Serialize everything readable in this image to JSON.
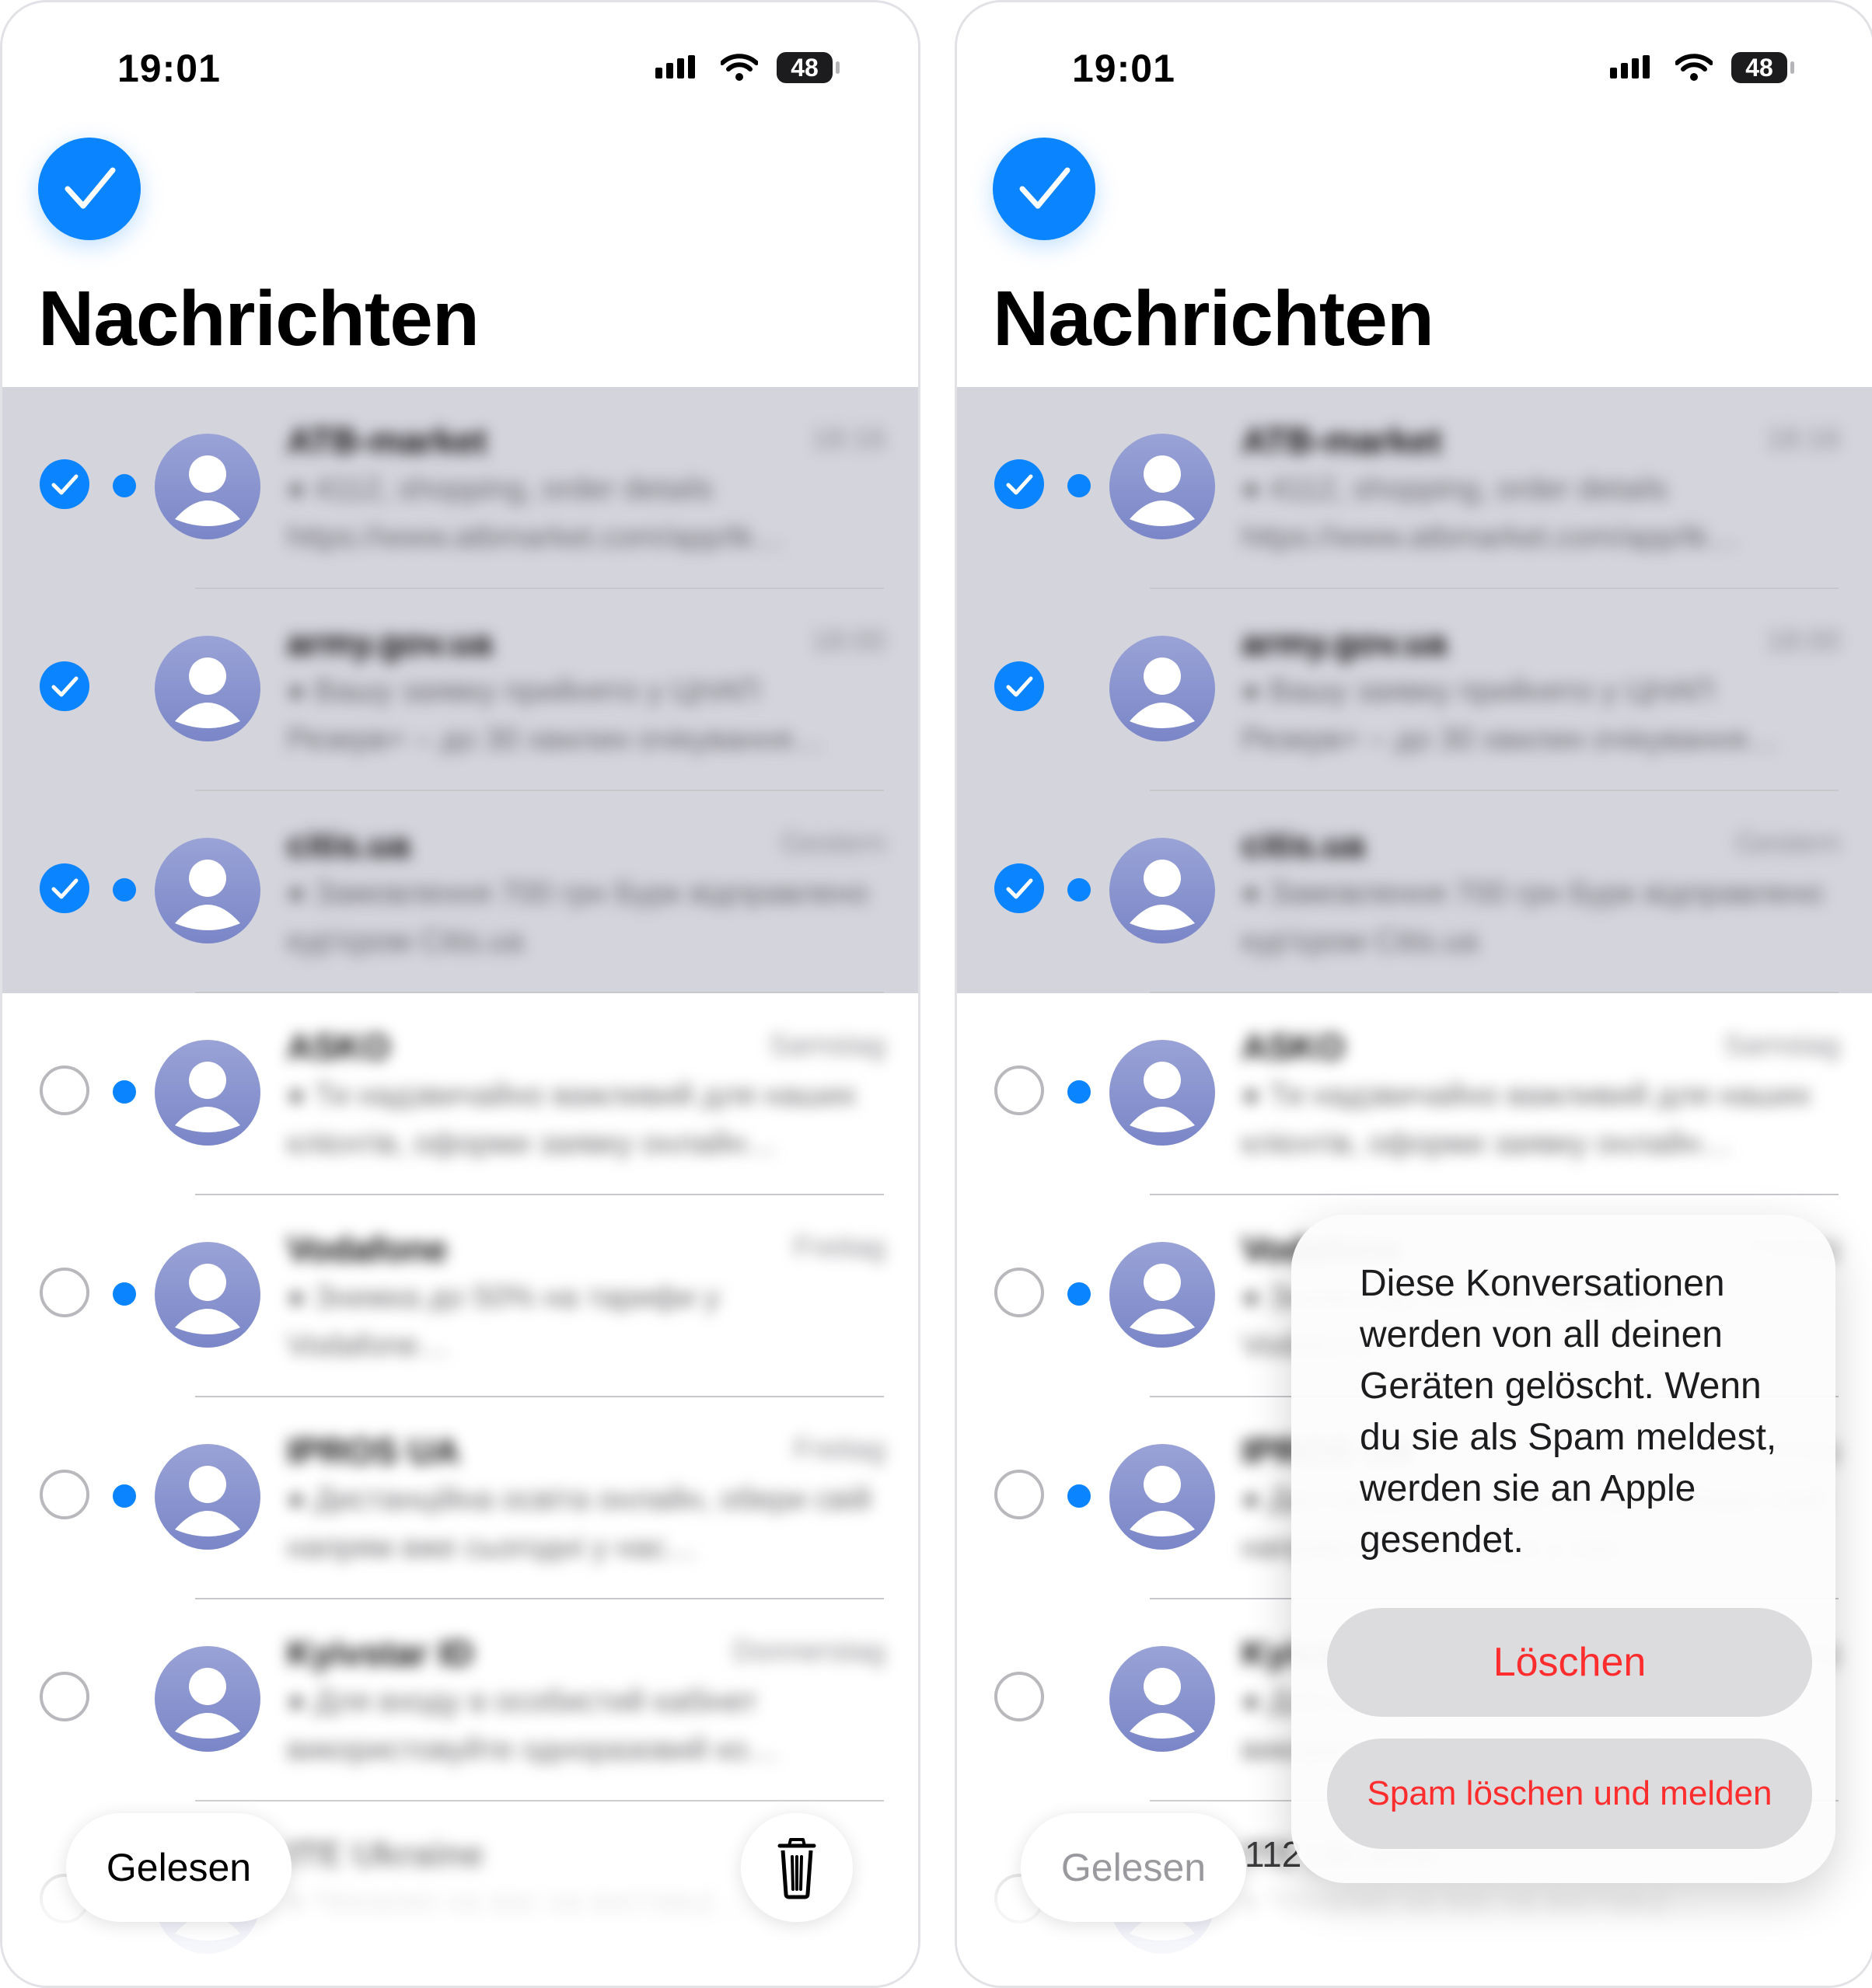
{
  "status": {
    "time": "19:01",
    "battery": "48"
  },
  "title": "Nachrichten",
  "conversations": [
    {
      "sender": "ATB-market",
      "time": "18:16",
      "preview": "● 4112, shopping, order details https://www.atbmarket.com/app/tk…",
      "selected": true,
      "unread": true
    },
    {
      "sender": "army.gov.ua",
      "time": "18:00",
      "preview": "● Вашу заявку прийнято у ЦНАП Резерв+ – до 30 хвилин очікування…",
      "selected": true,
      "unread": false
    },
    {
      "sender": "citis.ua",
      "time": "Gestern",
      "preview": "● Замовлення 700 грн Бурк відправлено кур'єром Citis.ua",
      "selected": true,
      "unread": true
    },
    {
      "sender": "ASKO",
      "time": "Samstag",
      "preview": "● Ти надзвичайно важливий для наших клієнтів, оформи заявку онлайн…",
      "selected": false,
      "unread": true
    },
    {
      "sender": "Vodafone",
      "time": "Freitag",
      "preview": "● Знижка до 50% на тарифи у Vodafone…",
      "selected": false,
      "unread": true
    },
    {
      "sender": "IPROS UA",
      "time": "Freitag",
      "preview": "● Дистанційна освіта онлайн, обери свій напрям вже сьогодні у нас…",
      "selected": false,
      "unread": true
    },
    {
      "sender": "Kyivstar ID",
      "time": "Donnerstag",
      "preview": "● Для входу в особистий кабінет використовуйте одноразовий ко…",
      "selected": false,
      "unread": false
    },
    {
      "sender": "ITE Ukraine",
      "time": "",
      "preview": "● Чекаємо на вас на виставці…",
      "selected": false,
      "unread": true
    }
  ],
  "toolbar": {
    "read_label": "Gelesen",
    "trash_icon": "trash-icon",
    "count_partial": "112"
  },
  "dialog": {
    "message": "Diese Konversationen werden von all deinen Geräten gelöscht. Wenn du sie als Spam meldest, werden sie an Apple gesendet.",
    "delete_label": "Löschen",
    "spam_label": "Spam löschen und melden"
  },
  "colors": {
    "accent": "#0a84ff",
    "destructive": "#ff2d2d",
    "selected_band": "#d4d4dc"
  },
  "icons": {
    "select_all": "checkmark-circle-icon",
    "row_check": "checkmark-icon",
    "avatar": "person-icon",
    "unread": "unread-dot"
  }
}
